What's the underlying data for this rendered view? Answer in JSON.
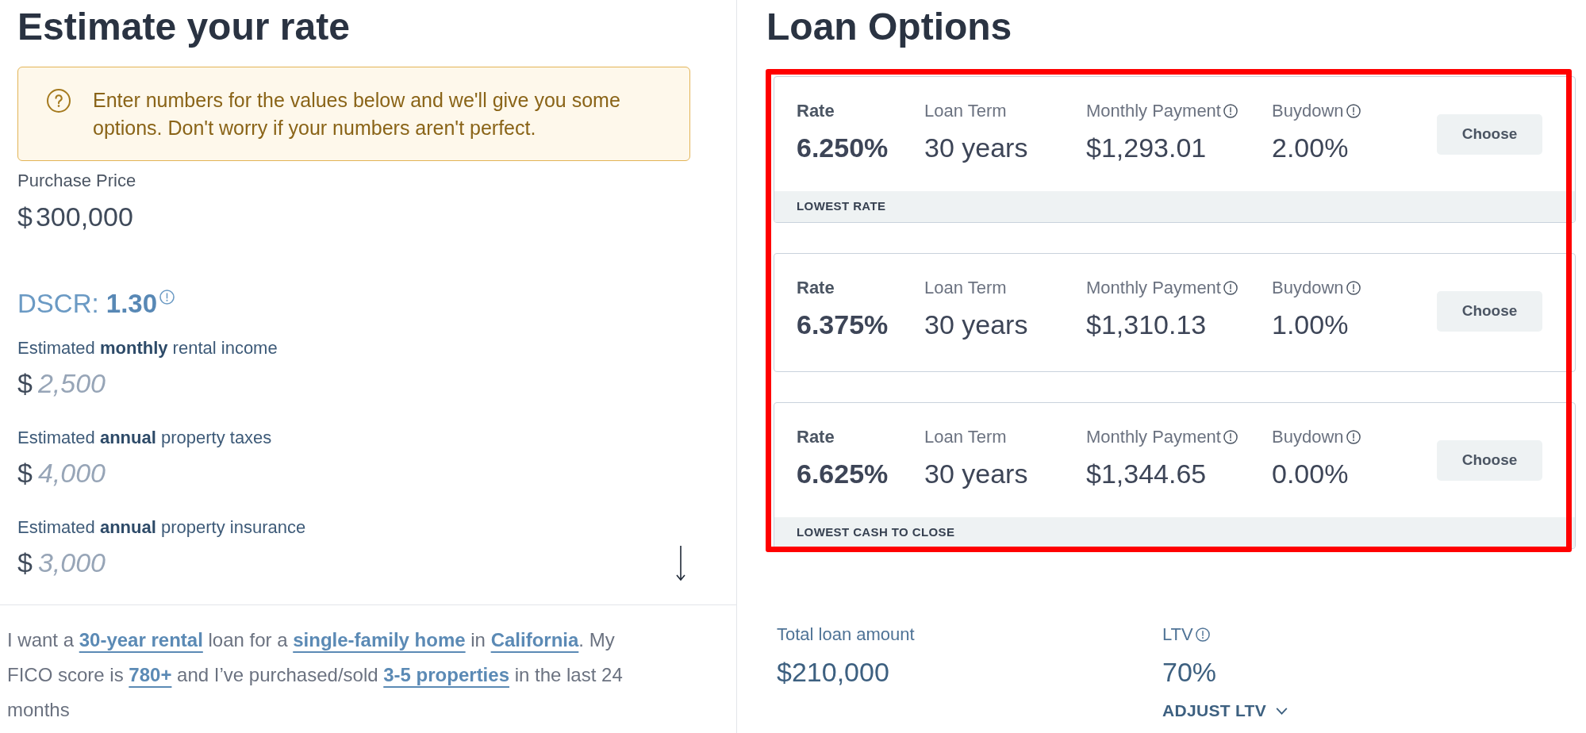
{
  "estimate": {
    "title": "Estimate your rate",
    "notice": "Enter numbers for the values below and we'll give you some options. Don't worry if your numbers aren't perfect.",
    "purchase_price": {
      "label": "Purchase Price",
      "currency": "$",
      "value": "300,000"
    },
    "dscr": {
      "text": "DSCR: **1.30**",
      "info": true
    },
    "fields": [
      {
        "label": "Estimated **monthly** rental income",
        "currency": "$",
        "placeholder": "2,500"
      },
      {
        "label": "Estimated **annual** property taxes",
        "currency": "$",
        "placeholder": "4,000"
      },
      {
        "label": "Estimated **annual** property insurance",
        "currency": "$",
        "placeholder": "3,000"
      }
    ],
    "summary": [
      {
        "kind": "text",
        "text": "I want a "
      },
      {
        "kind": "link",
        "text": "30-year rental"
      },
      {
        "kind": "text",
        "text": " loan for a "
      },
      {
        "kind": "link",
        "text": "single-family home"
      },
      {
        "kind": "text",
        "text": " in "
      },
      {
        "kind": "link",
        "text": "California"
      },
      {
        "kind": "text",
        "text": ". My FICO score is "
      },
      {
        "kind": "link",
        "text": "780+"
      },
      {
        "kind": "text",
        "text": " and I’ve purchased/sold "
      },
      {
        "kind": "link",
        "text": "3-5 properties"
      },
      {
        "kind": "text",
        "text": " in the last 24 months"
      }
    ]
  },
  "loan_options": {
    "title": "Loan Options",
    "highlighted": true,
    "options": [
      {
        "columns": [
          {
            "label": "Rate",
            "value": "6.250%",
            "info": false
          },
          {
            "label": "Loan Term",
            "value": "30 years",
            "info": false
          },
          {
            "label": "Monthly Payment",
            "value": "$1,293.01",
            "info": true
          },
          {
            "label": "Buydown",
            "value": "2.00%",
            "info": true
          }
        ],
        "button": "Choose",
        "tag": "LOWEST RATE"
      },
      {
        "columns": [
          {
            "label": "Rate",
            "value": "6.375%",
            "info": false
          },
          {
            "label": "Loan Term",
            "value": "30 years",
            "info": false
          },
          {
            "label": "Monthly Payment",
            "value": "$1,310.13",
            "info": true
          },
          {
            "label": "Buydown",
            "value": "1.00%",
            "info": true
          }
        ],
        "button": "Choose"
      },
      {
        "columns": [
          {
            "label": "Rate",
            "value": "6.625%",
            "info": false
          },
          {
            "label": "Loan Term",
            "value": "30 years",
            "info": false
          },
          {
            "label": "Monthly Payment",
            "value": "$1,344.65",
            "info": true
          },
          {
            "label": "Buydown",
            "value": "0.00%",
            "info": true
          }
        ],
        "button": "Choose",
        "tag": "LOWEST CASH TO CLOSE"
      }
    ],
    "stats": [
      {
        "label": "Total loan amount",
        "value": "$210,000",
        "info": false
      },
      {
        "label": "LTV",
        "value": "70%",
        "info": true
      }
    ],
    "adjust": "ADJUST LTV"
  }
}
